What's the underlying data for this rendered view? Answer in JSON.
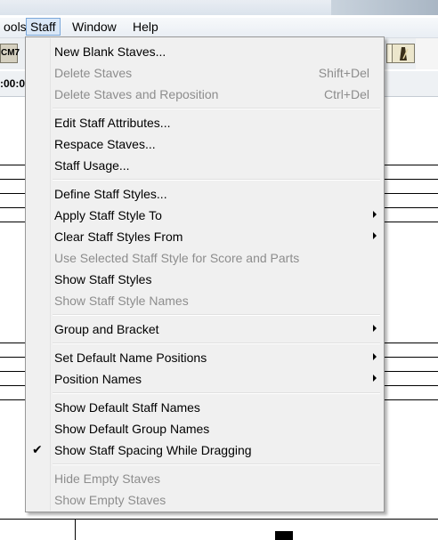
{
  "menubar": {
    "items": [
      "ools",
      "Staff",
      "Window",
      "Help"
    ]
  },
  "toolbar": {
    "chord_button": "CM7",
    "time": ":00:0"
  },
  "staff_menu": {
    "new_blank": "New Blank Staves...",
    "delete": "Delete Staves",
    "delete_sc": "Shift+Del",
    "delete_repos": "Delete Staves and Reposition",
    "delete_repos_sc": "Ctrl+Del",
    "edit_attr": "Edit Staff Attributes...",
    "respace": "Respace Staves...",
    "usage": "Staff Usage...",
    "define_styles": "Define Staff Styles...",
    "apply_style": "Apply Staff Style To",
    "clear_styles": "Clear Staff Styles From",
    "use_selected": "Use Selected Staff Style for Score and Parts",
    "show_styles": "Show Staff Styles",
    "show_style_names": "Show Staff Style Names",
    "group_bracket": "Group and Bracket",
    "default_name_pos": "Set Default Name Positions",
    "position_names": "Position Names",
    "show_default_staff_names": "Show Default Staff Names",
    "show_default_group_names": "Show Default Group Names",
    "show_spacing": "Show Staff Spacing While Dragging",
    "check": "✔",
    "hide_empty": "Hide Empty Staves",
    "show_empty": "Show Empty Staves"
  }
}
